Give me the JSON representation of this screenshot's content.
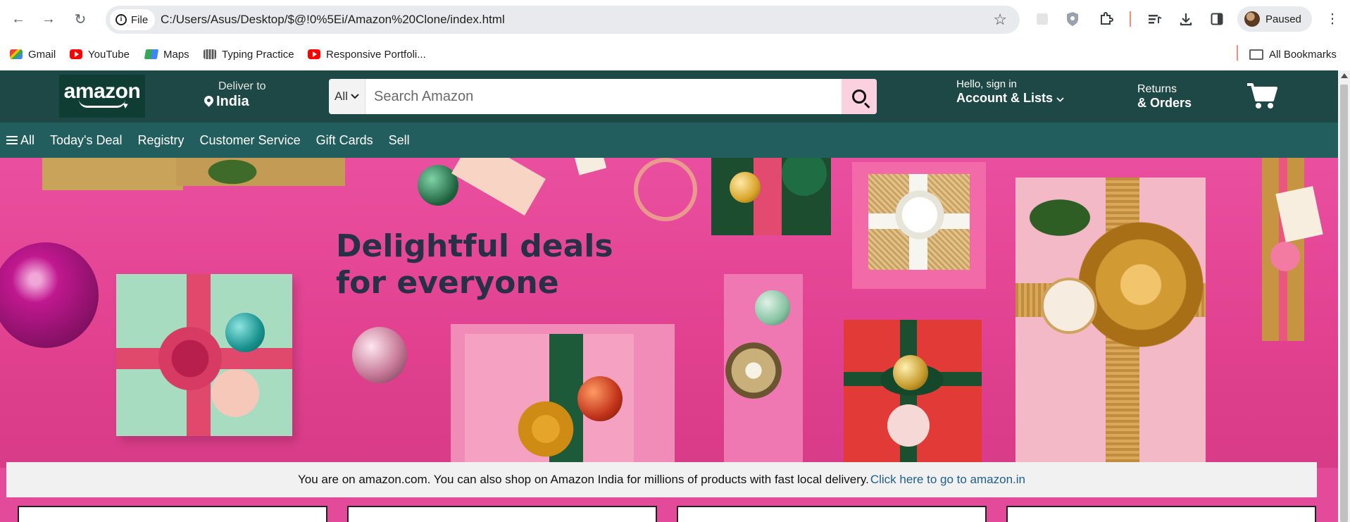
{
  "browser": {
    "file_chip_label": "File",
    "url": "C:/Users/Asus/Desktop/$@!0%5Ei/Amazon%20Clone/index.html",
    "profile_status": "Paused",
    "bookmarks": [
      {
        "label": "Gmail",
        "icon": "gmail-icon"
      },
      {
        "label": "YouTube",
        "icon": "youtube-icon"
      },
      {
        "label": "Maps",
        "icon": "maps-icon"
      },
      {
        "label": "Typing Practice",
        "icon": "typing-practice-icon"
      },
      {
        "label": "Responsive Portfoli...",
        "icon": "youtube-icon"
      }
    ],
    "all_bookmarks_label": "All Bookmarks"
  },
  "amazon": {
    "logo_text": "amazon",
    "deliver_label": "Deliver to",
    "deliver_location": "India",
    "search_category": "All",
    "search_placeholder": "Search Amazon",
    "account_hello": "Hello, sign in",
    "account_main": "Account & Lists",
    "returns_line1": "Returns",
    "returns_line2": "& Orders",
    "sub_nav": [
      "All",
      "Today's Deal",
      "Registry",
      "Customer Service",
      "Gift Cards",
      "Sell"
    ],
    "hero_title_line1": "Delightful deals",
    "hero_title_line2": "for everyone",
    "notice_text": "You are on amazon.com. You can also shop on Amazon India for millions of products with fast local delivery.",
    "notice_link": "Click here to go to amazon.in"
  },
  "colors": {
    "nav_dark": "#1d4845",
    "nav_secondary": "#225e5e",
    "hero_pink": "#e44a9a",
    "search_button": "#fbd0df",
    "hero_text": "#283047",
    "link_blue": "#1f5e8a"
  }
}
